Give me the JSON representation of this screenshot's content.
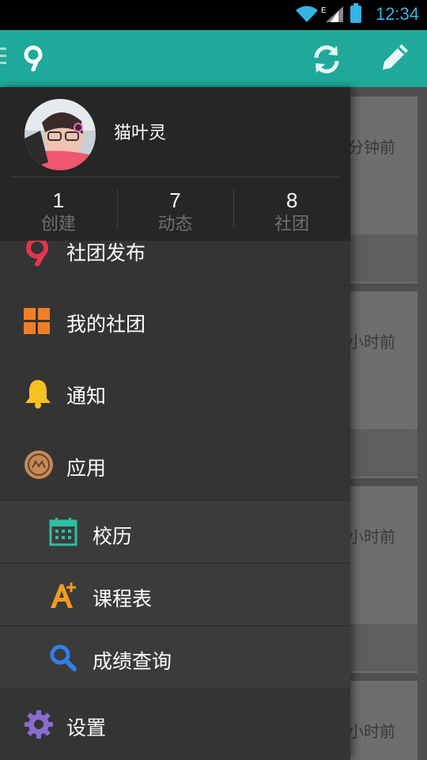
{
  "status_bar": {
    "time": "12:34",
    "network": "E",
    "accent_color": "#33b5e5",
    "icons": [
      "wifi-icon",
      "signal-icon",
      "battery-icon"
    ]
  },
  "app_bar": {
    "color": "#1fa99a",
    "icons": [
      "menu-icon",
      "app-logo",
      "refresh-icon",
      "compose-icon"
    ]
  },
  "profile": {
    "username": "猫叶灵",
    "stats": [
      {
        "value": "1",
        "label": "创建"
      },
      {
        "value": "7",
        "label": "动态"
      },
      {
        "value": "8",
        "label": "社团"
      }
    ]
  },
  "menu": {
    "publish": {
      "label": "社团发布",
      "icon": "location-pin-icon"
    },
    "my_clubs": {
      "label": "我的社团",
      "icon": "grid-icon"
    },
    "notifications": {
      "label": "通知",
      "icon": "bell-icon"
    },
    "apps": {
      "label": "应用",
      "icon": "apps-badge-icon"
    },
    "calendar": {
      "label": "校历",
      "icon": "calendar-icon"
    },
    "timetable": {
      "label": "课程表",
      "icon": "timetable-icon"
    },
    "grades": {
      "label": "成绩查询",
      "icon": "search-icon"
    },
    "settings": {
      "label": "设置",
      "icon": "gear-icon"
    }
  },
  "feed": {
    "timestamps": [
      "分钟前",
      "小时前",
      "小时前",
      "小时前"
    ]
  }
}
